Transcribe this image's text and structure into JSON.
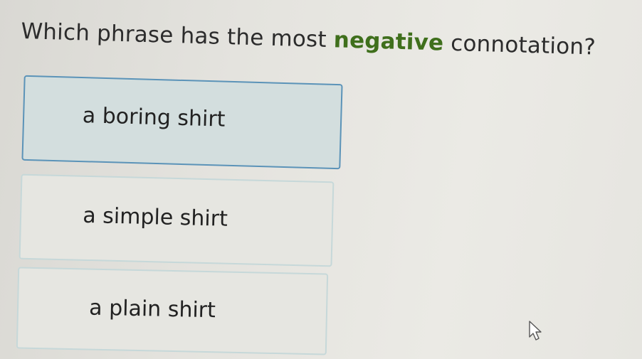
{
  "question": {
    "prefix": "Which phrase has the most ",
    "keyword": "negative",
    "suffix": " connotation?",
    "keyword_color": "#3f6f1c"
  },
  "choices": [
    {
      "label": "a boring shirt",
      "selected": true
    },
    {
      "label": "a simple shirt",
      "selected": false
    },
    {
      "label": "a plain shirt",
      "selected": false
    }
  ],
  "colors": {
    "selected_border": "#5b93b8",
    "selected_fill": "#d3dede",
    "choice_border": "#c6d8d9"
  },
  "icons": {
    "pointer": "mouse-pointer-icon"
  }
}
